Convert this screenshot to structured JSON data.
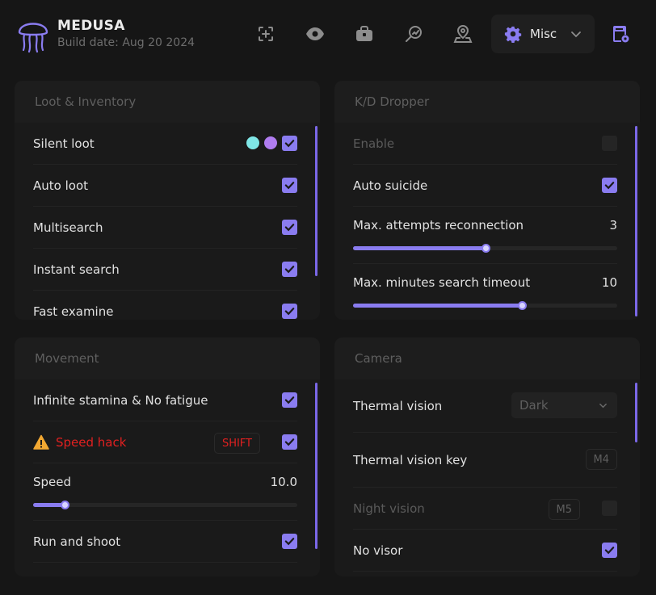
{
  "header": {
    "app_name": "MEDUSA",
    "build_date": "Build date: Aug 20 2024",
    "nav_icons": [
      "aim-icon",
      "eye-icon",
      "briefcase-icon",
      "search-chart-icon",
      "map-pin-icon"
    ],
    "misc_label": "Misc",
    "accent": "#8a7cf0"
  },
  "loot": {
    "title": "Loot & Inventory",
    "items": [
      {
        "label": "Silent loot",
        "checked": true,
        "colors": [
          "#7fe6e6",
          "#b07cf0"
        ]
      },
      {
        "label": "Auto loot",
        "checked": true
      },
      {
        "label": "Multisearch",
        "checked": true
      },
      {
        "label": "Instant search",
        "checked": true
      },
      {
        "label": "Fast examine",
        "checked": true
      }
    ]
  },
  "kd": {
    "title": "K/D Dropper",
    "enable_label": "Enable",
    "enable_checked": false,
    "auto_suicide_label": "Auto suicide",
    "auto_suicide_checked": true,
    "reconnect_label": "Max. attempts reconnection",
    "reconnect_value": "3",
    "reconnect_fraction": 0.5,
    "timeout_label": "Max. minutes search timeout",
    "timeout_value": "10",
    "timeout_fraction": 0.64
  },
  "movement": {
    "title": "Movement",
    "stamina_label": "Infinite stamina & No fatigue",
    "stamina_checked": true,
    "speed_hack_label": "Speed hack",
    "speed_hack_key": "SHIFT",
    "speed_hack_checked": true,
    "speed_label": "Speed",
    "speed_value": "10.0",
    "speed_fraction": 0.12,
    "run_shoot_label": "Run and shoot",
    "run_shoot_checked": true,
    "warning_color": "#e02020"
  },
  "camera": {
    "title": "Camera",
    "thermal_label": "Thermal vision",
    "thermal_mode": "Dark",
    "thermal_key_label": "Thermal vision key",
    "thermal_key": "M4",
    "night_label": "Night vision",
    "night_key": "M5",
    "night_checked": false,
    "no_visor_label": "No visor",
    "no_visor_checked": true
  }
}
